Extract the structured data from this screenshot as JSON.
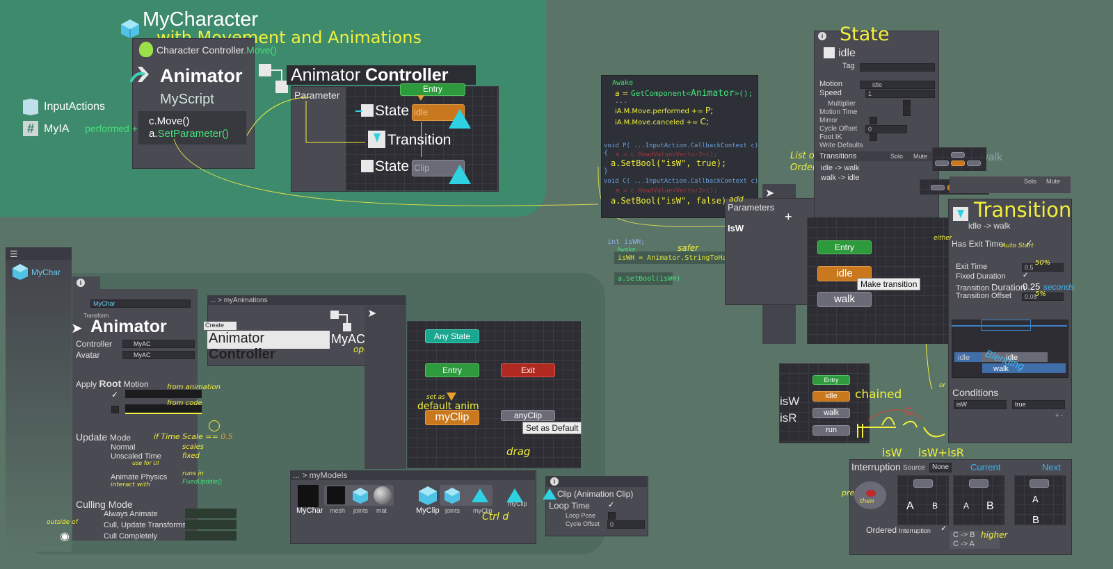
{
  "colors": {
    "yellow": "#f2f03c",
    "green": "#46e07a",
    "teal": "#2fd2e2",
    "orange": "#c9781e",
    "red": "#b02a22",
    "bg": "#5b7468"
  },
  "top": {
    "title": "MyCharacter",
    "subtitle": "with Movement and Animations",
    "char_ctrl": "Character Controller",
    "char_ctrl_move": ".Move()",
    "animator": "Animator",
    "myscript": "MyScript",
    "input_actions": "InputActions",
    "myia": "MyIA",
    "performed": "performed +",
    "cmove": "c.Move()",
    "aset_a": "a.",
    "aset_b": "SetParameter()",
    "ac_title_a": "Animator",
    "ac_title_b": "Controller",
    "parameter": "Parameter",
    "entry": "Entry",
    "state1": "State",
    "idle": "idle",
    "transition": "Transition",
    "state2": "State",
    "clip": "Clip"
  },
  "code": {
    "awake": "Awake",
    "l1a": "a = ",
    "l1b": "GetComponent<",
    "l1c": "Animator",
    ">": ">();",
    "l2": "...",
    "l3a": "iA.M.Move.performed += ",
    "l3b": "P;",
    "l4a": "iA.M.Move.canceled += ",
    "l4b": "C;",
    "p_sig": "void P(  ...InputAction.CallbackContext c)",
    "p_body": "m = c.ReadValue<Vector2>();",
    "p_set": "a.SetBool(\"isW\", true);",
    "c_sig": "void C(  ...InputAction.CallbackContext c)",
    "c_body": "m = c.ReadValue<Vector2>();",
    "c_set": "a.SetBool(\"isW\", false);",
    "brace_o": "{",
    "brace_c": "}",
    "int_iswh": "int isWH;",
    "awake2": "Awake",
    "safer": "safer",
    "hash": "isWH = Animator.StringToHash(\"isW\")",
    "setbool_hash": "a.SetBool(isWH)"
  },
  "params": {
    "title": "Parameters",
    "add": "add",
    "plus": "+",
    "isw": "IsW",
    "list_of": "List of",
    "order": "Order:"
  },
  "state_panel": {
    "title": "State",
    "name": "idle",
    "tag": "Tag",
    "motion": "Motion",
    "motion_val": "idle",
    "speed": "Speed",
    "speed_val": "1",
    "multiplier": "Multiplier",
    "motion_time": "Motion Time",
    "mirror": "Mirror",
    "cycle_offset": "Cycle Offset",
    "cycle_val": "0",
    "foot_ik": "Foot IK",
    "write_defaults": "Write Defaults",
    "transitions": "Transitions",
    "solo": "Solo",
    "mute": "Mute",
    "t1": "idle -> walk",
    "t2": "walk -> idle",
    "ghost": "-> walk"
  },
  "graph2": {
    "entry": "Entry",
    "idle": "idle",
    "walk": "walk",
    "make": "Make transition"
  },
  "transition_panel": {
    "title": "Transition",
    "sub": "idle -> walk",
    "either": "either",
    "has_exit": "Has Exit Time",
    "auto_start": "Auto Start",
    "exit_time": "Exit Time",
    "exit_val": "0.5",
    "pct50": "50%",
    "fixed": "Fixed Duration",
    "td_a": "Transition",
    "td_b": "Duration",
    "td_val": "0.25",
    "seconds": "seconds",
    "offset": "Transition Offset",
    "offset_val": "0.05",
    "pct5": "5%",
    "bl_idle": "idle",
    "bl_idle2": "idle",
    "bl_walk": "walk",
    "blending": "Blending",
    "or": "or",
    "conditions": "Conditions",
    "cond_param": "isW",
    "cond_val": "true",
    "pm": "+ -"
  },
  "chain": {
    "entry": "Entry",
    "idle": "idle",
    "walk": "walk",
    "run": "run",
    "isw": "isW",
    "isr": "isR",
    "chained": "chained",
    "isw2": "isW",
    "iswr": "isW+isR"
  },
  "interrupt": {
    "title": "Interruption",
    "source": "Source",
    "none": "None",
    "current": "Current",
    "next": "Next",
    "press": "press",
    "then": "then",
    "a": "A",
    "b": "B",
    "ordered": "Ordered",
    "interruption": "Interruption",
    "cb": "C -> B",
    "higher": "higher",
    "ca": "C -> A"
  },
  "left": {
    "mychar": "MyChar",
    "mychar_field": "MyChar",
    "transform": "Transform",
    "animator": "Animator",
    "controller": "Controller",
    "controller_val": "MyAC",
    "avatar": "Avatar",
    "avatar_val": "MyAC",
    "apply": "Apply",
    "root": "Root",
    "motion": "Motion",
    "from_anim": "from animation",
    "from_code": "from code",
    "update_a": "Update",
    "update_b": "Mode",
    "if_ts": "if Time Scale == ",
    "ts_val": "0.5",
    "normal": "Normal",
    "scales": "scales",
    "unscaled": "Unscaled Time",
    "fixed": "fixed",
    "use_ui": "use for UI",
    "anim_phys": "Animate Physics",
    "runs_in": "runs in",
    "fixedupdate": "FixedUpdate()",
    "interact": "interact with",
    "culling": "Culling Mode",
    "always": "Always Animate",
    "cull_upd": "Cull, Update Transforms",
    "cull_comp": "Cull Completely",
    "outside": "outside of"
  },
  "myanims": {
    "path": "... > myAnimations",
    "create": "Create",
    "ac_a": "Animator",
    "ac_b": "Controller",
    "myac": "MyAC",
    "open": "open"
  },
  "graph1": {
    "any": "Any State",
    "entry": "Entry",
    "exit": "Exit",
    "myclip": "myClip",
    "anyclip": "anyClip",
    "set_default": "Set as Default",
    "set_as": "set as",
    "default_anim": "default anim",
    "drag": "drag"
  },
  "models": {
    "path": "... > myModels",
    "mychar": "MyChar",
    "mesh": "mesh",
    "joints": "joints",
    "mat": "mat",
    "myclip": "MyClip",
    "joints2": "joints",
    "myclip2": "myClip",
    "myclip3": "myClip",
    "ctrl": "Ctrl d"
  },
  "clip": {
    "title": "Clip (Animation Clip)",
    "loop_a": "Loop",
    "loop_b": "Time",
    "loop_pose": "Loop Pose",
    "cycle": "Cycle Offset",
    "cycle_val": "0"
  }
}
